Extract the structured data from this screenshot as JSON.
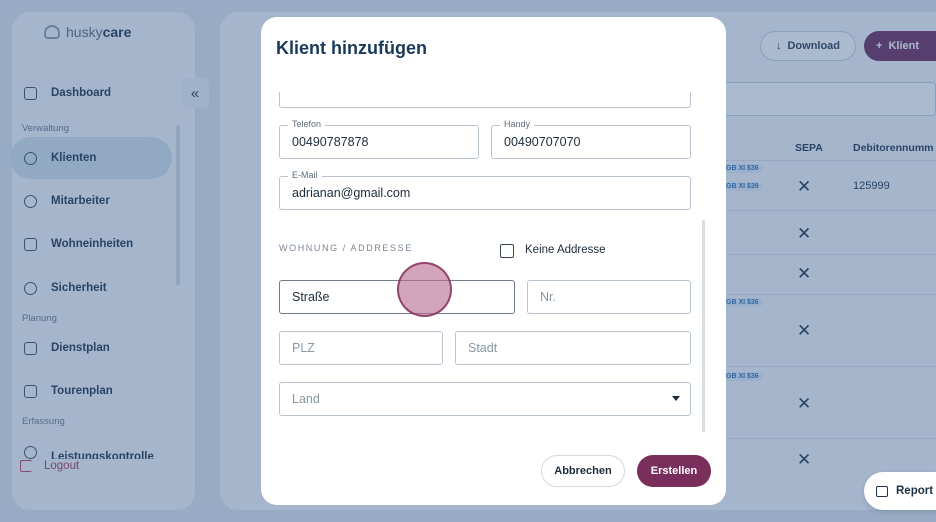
{
  "sidebar": {
    "logo_prefix": "husky",
    "logo_suffix": "care",
    "collapse": "«",
    "sections": [
      "Verwaltung",
      "Planung",
      "Erfassung"
    ],
    "items": [
      {
        "label": "Dashboard"
      },
      {
        "label": "Klienten"
      },
      {
        "label": "Mitarbeiter"
      },
      {
        "label": "Wohneinheiten"
      },
      {
        "label": "Sicherheit"
      },
      {
        "label": "Dienstplan"
      },
      {
        "label": "Tourenplan"
      },
      {
        "label": "Leistungskontrolle"
      }
    ],
    "logout": "Logout"
  },
  "header": {
    "download": "Download",
    "add": "Klient",
    "download_icon": "↓",
    "add_icon": "+"
  },
  "table": {
    "col_sepa": "SEPA",
    "col_debitor": "Debitorennumm",
    "x_mark": "✕",
    "chip1": "GB XI $36",
    "chip2": "GB XI $39",
    "debitor_value": "125999"
  },
  "report": {
    "label": "Report a"
  },
  "modal": {
    "title": "Klient hinzufügen",
    "telefon_label": "Telefon",
    "telefon_value": "00490787878",
    "handy_label": "Handy",
    "handy_value": "00490707070",
    "email_label": "E-Mail",
    "email_value": "adrianan@gmail.com",
    "section": "WOHNUNG / ADDRESSE",
    "keine_adresse": "Keine Addresse",
    "strasse": "Straße",
    "nr": "Nr.",
    "plz": "PLZ",
    "stadt": "Stadt",
    "land": "Land",
    "cancel": "Abbrechen",
    "create": "Erstellen"
  }
}
